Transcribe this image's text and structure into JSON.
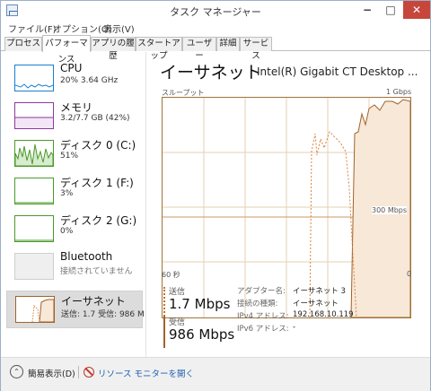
{
  "window": {
    "title": "タスク マネージャー",
    "min_symbol": "−",
    "max_symbol": "□",
    "close_symbol": "✕"
  },
  "menu": [
    "ファイル(F)",
    "オプション(O)",
    "表示(V)"
  ],
  "tabs": [
    {
      "label": "プロセス",
      "active": false
    },
    {
      "label": "パフォーマンス",
      "active": true
    },
    {
      "label": "アプリの履歴",
      "active": false
    },
    {
      "label": "スタートアップ",
      "active": false
    },
    {
      "label": "ユーザー",
      "active": false
    },
    {
      "label": "詳細",
      "active": false
    },
    {
      "label": "サービス",
      "active": false
    }
  ],
  "resources": [
    {
      "name": "CPU",
      "value": "20% 3.64 GHz",
      "color": "#1a7fcf"
    },
    {
      "name": "メモリ",
      "value": "3.2/7.7 GB (42%)",
      "color": "#8b3a9e"
    },
    {
      "name": "ディスク 0 (C:)",
      "value": "51%",
      "color": "#4a9a2a"
    },
    {
      "name": "ディスク 1 (F:)",
      "value": "3%",
      "color": "#4a9a2a"
    },
    {
      "name": "ディスク 2 (G:)",
      "value": "0%",
      "color": "#4a9a2a"
    },
    {
      "name": "Bluetooth",
      "value": "接続されていません",
      "color": "#bbbbbb"
    },
    {
      "name": "イーサネット",
      "value": "送信: 1.7 受信: 986 M",
      "color": "#a0622a"
    }
  ],
  "detail": {
    "title": "イーサネット",
    "adapter": "Intel(R) Gigabit CT Desktop ...",
    "throughput_label": "スループット",
    "max_label": "1 Gbps",
    "mid_label": "300 Mbps",
    "time_left_label": "60 秒",
    "time_right_label": "0",
    "send_label": "送信",
    "send_value": "1.7 Mbps",
    "recv_label": "受信",
    "recv_value": "986 Mbps",
    "info": [
      {
        "label": "アダプター名:",
        "value": "イーサネット 3"
      },
      {
        "label": "接続の種類:",
        "value": "イーサネット"
      },
      {
        "label": "IPv4 アドレス:",
        "value": "192.168.10.119"
      },
      {
        "label": "IPv6 アドレス:",
        "value": "-"
      }
    ]
  },
  "footer": {
    "fewer_icon": "⌃",
    "fewer_label": "簡易表示(D)",
    "resmon_label": "リソース モニターを開く"
  },
  "colors": {
    "accent": "#a0622a",
    "send_line": "#d9823d",
    "recv_fill": "#f8e8d8",
    "link": "#1c5fb0"
  }
}
